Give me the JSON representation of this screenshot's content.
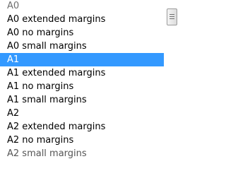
{
  "list": {
    "items": [
      "A0",
      "A0 extended margins",
      "A0 no margins",
      "A0 small margins",
      "A1",
      "A1 extended margins",
      "A1 no margins",
      "A1 small margins",
      "A2",
      "A2 extended margins",
      "A2 no margins",
      "A2 small margins"
    ],
    "selected": "A1"
  },
  "scrollbar": {
    "thumb_icon": "scroll-grip-icon"
  }
}
